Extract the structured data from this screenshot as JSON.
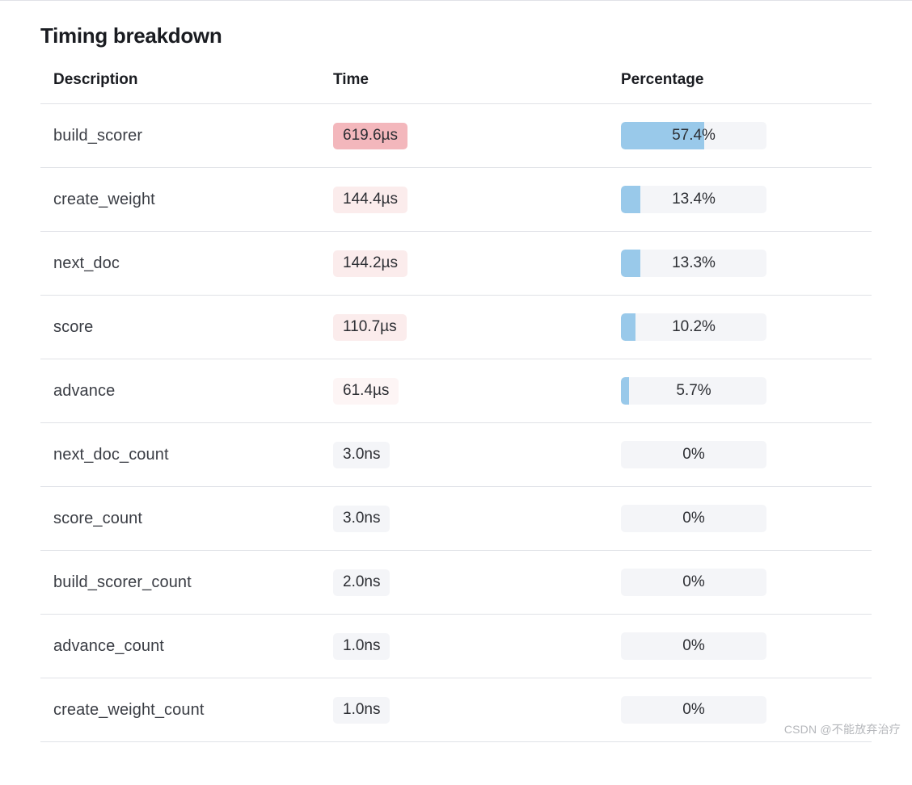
{
  "title": "Timing breakdown",
  "columns": {
    "description": "Description",
    "time": "Time",
    "percentage": "Percentage"
  },
  "time_colors": {
    "high": "#f3b7bc",
    "mid": "#fbecec",
    "low": "#fdf5f5",
    "none": "#f4f5f8"
  },
  "bar_color": "#99c9ea",
  "rows": [
    {
      "description": "build_scorer",
      "time": "619.6µs",
      "time_level": "high",
      "percent": 57.4,
      "percent_label": "57.4%"
    },
    {
      "description": "create_weight",
      "time": "144.4µs",
      "time_level": "mid",
      "percent": 13.4,
      "percent_label": "13.4%"
    },
    {
      "description": "next_doc",
      "time": "144.2µs",
      "time_level": "mid",
      "percent": 13.3,
      "percent_label": "13.3%"
    },
    {
      "description": "score",
      "time": "110.7µs",
      "time_level": "mid",
      "percent": 10.2,
      "percent_label": "10.2%"
    },
    {
      "description": "advance",
      "time": "61.4µs",
      "time_level": "low",
      "percent": 5.7,
      "percent_label": "5.7%"
    },
    {
      "description": "next_doc_count",
      "time": "3.0ns",
      "time_level": "none",
      "percent": 0,
      "percent_label": "0%"
    },
    {
      "description": "score_count",
      "time": "3.0ns",
      "time_level": "none",
      "percent": 0,
      "percent_label": "0%"
    },
    {
      "description": "build_scorer_count",
      "time": "2.0ns",
      "time_level": "none",
      "percent": 0,
      "percent_label": "0%"
    },
    {
      "description": "advance_count",
      "time": "1.0ns",
      "time_level": "none",
      "percent": 0,
      "percent_label": "0%"
    },
    {
      "description": "create_weight_count",
      "time": "1.0ns",
      "time_level": "none",
      "percent": 0,
      "percent_label": "0%"
    }
  ],
  "watermark": "CSDN @不能放弃治疗"
}
